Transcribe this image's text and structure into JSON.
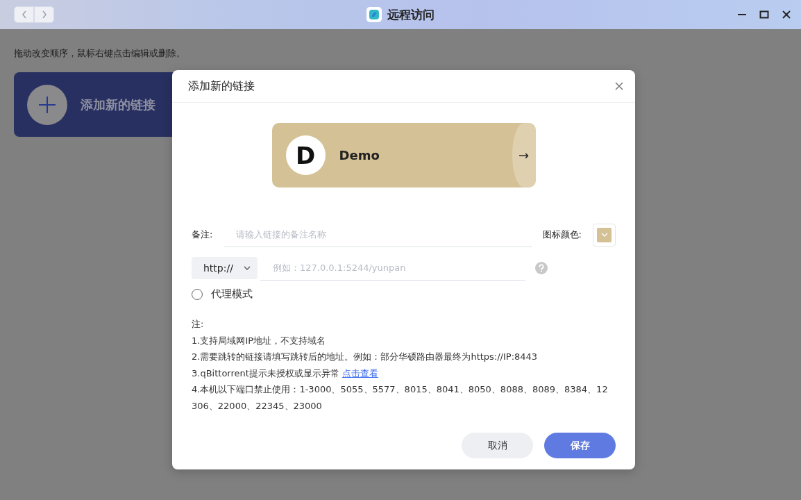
{
  "window": {
    "title": "远程访问"
  },
  "hint": "拖动改变顺序，鼠标右键点击编辑或删除。",
  "add_tile": {
    "label": "添加新的链接"
  },
  "dialog": {
    "title": "添加新的链接",
    "preview": {
      "letter": "D",
      "name": "Demo",
      "arrow": "→",
      "color": "#d4c196"
    },
    "remark": {
      "label": "备注:",
      "placeholder": "请输入链接的备注名称"
    },
    "icon_color": {
      "label": "图标颜色:",
      "color": "#d4c196"
    },
    "protocol": {
      "value": "http://"
    },
    "address": {
      "placeholder": "例如：127.0.0.1:5244/yunpan"
    },
    "proxy": {
      "label": "代理模式",
      "checked": false
    },
    "notes": [
      "注:",
      "1.支持局域网IP地址，不支持域名",
      "2.需要跳转的链接请填写跳转后的地址。例如：部分华硕路由器最终为https://IP:8443",
      {
        "text": "3.qBittorrent提示未授权或显示异常",
        "link": "点击查看"
      },
      "4.本机以下端口禁止使用：1-3000、5055、5577、8015、8041、8050、8088、8089、8384、12306、22000、22345、23000"
    ],
    "buttons": [
      {
        "label": "取消",
        "kind": "secondary"
      },
      {
        "label": "保存",
        "kind": "primary"
      }
    ]
  }
}
